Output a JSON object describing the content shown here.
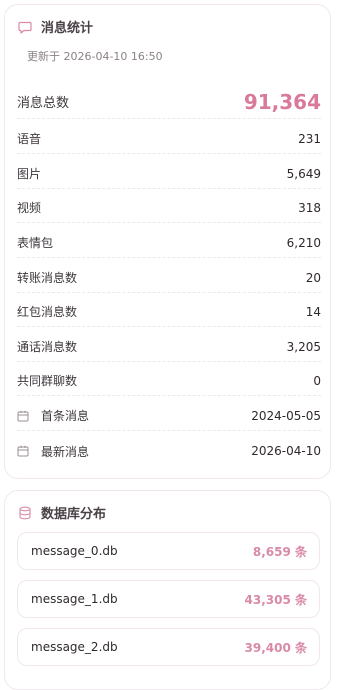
{
  "stats": {
    "title": "消息统计",
    "updated": "更新于 2026-04-10 16:50",
    "total_label": "消息总数",
    "total_value": "91,364",
    "rows": [
      {
        "label": "语音",
        "value": "231"
      },
      {
        "label": "图片",
        "value": "5,649"
      },
      {
        "label": "视频",
        "value": "318"
      },
      {
        "label": "表情包",
        "value": "6,210"
      },
      {
        "label": "转账消息数",
        "value": "20"
      },
      {
        "label": "红包消息数",
        "value": "14"
      },
      {
        "label": "通话消息数",
        "value": "3,205"
      },
      {
        "label": "共同群聊数",
        "value": "0"
      }
    ],
    "first_label": "首条消息",
    "first_value": "2024-05-05",
    "last_label": "最新消息",
    "last_value": "2026-04-10"
  },
  "db": {
    "title": "数据库分布",
    "items": [
      {
        "name": "message_0.db",
        "count": "8,659 条"
      },
      {
        "name": "message_1.db",
        "count": "43,305 条"
      },
      {
        "name": "message_2.db",
        "count": "39,400 条"
      }
    ]
  },
  "colors": {
    "accent": "#d97a9c",
    "icon": "#d98aa8"
  }
}
